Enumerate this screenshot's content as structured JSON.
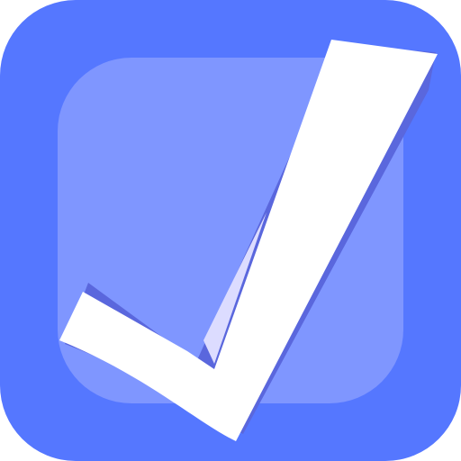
{
  "icon": {
    "name": "checkbox-checked-icon",
    "colors": {
      "tile": "#5577ff",
      "inner_box": "#7f96ff",
      "check_fill": "#ffffff",
      "check_shadow": "#5a67dd",
      "check_fold": "#dcdcff"
    }
  }
}
